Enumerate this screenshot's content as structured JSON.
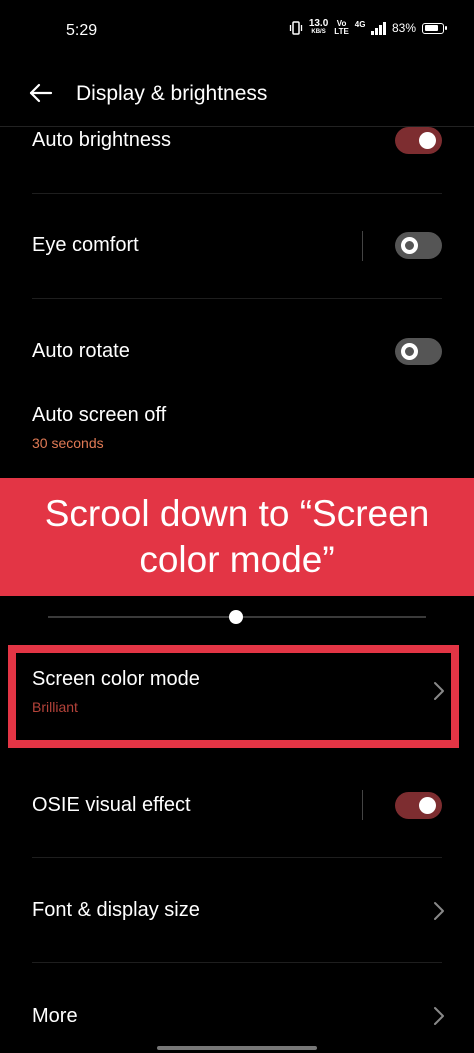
{
  "status_bar": {
    "time": "5:29",
    "speed_value": "13.0",
    "speed_unit": "KB/S",
    "volte_top": "Vo",
    "volte_bottom": "LTE",
    "network": "4G",
    "battery": "83%",
    "battery_level": 0.83
  },
  "header": {
    "title": "Display & brightness",
    "back_icon": "arrow-left-icon"
  },
  "settings": {
    "auto_brightness": {
      "label": "Auto brightness",
      "on": true
    },
    "eye_comfort": {
      "label": "Eye comfort",
      "on": false
    },
    "auto_rotate": {
      "label": "Auto rotate",
      "on": false
    },
    "auto_screen_off": {
      "label": "Auto screen off",
      "value": "30 seconds"
    },
    "screen_color_mode": {
      "label": "Screen color mode",
      "value": "Brilliant"
    },
    "osie_visual_effect": {
      "label": "OSIE visual effect",
      "on": true
    },
    "font_display_size": {
      "label": "Font & display size"
    },
    "more": {
      "label": "More"
    }
  },
  "annotation": {
    "text": "Scrool down to “Screen color mode”"
  },
  "colors": {
    "accent_red": "#e33545",
    "toggle_on": "#7d2d30",
    "subtitle_orange": "#e07a55",
    "subtitle_red": "#b5433a"
  }
}
